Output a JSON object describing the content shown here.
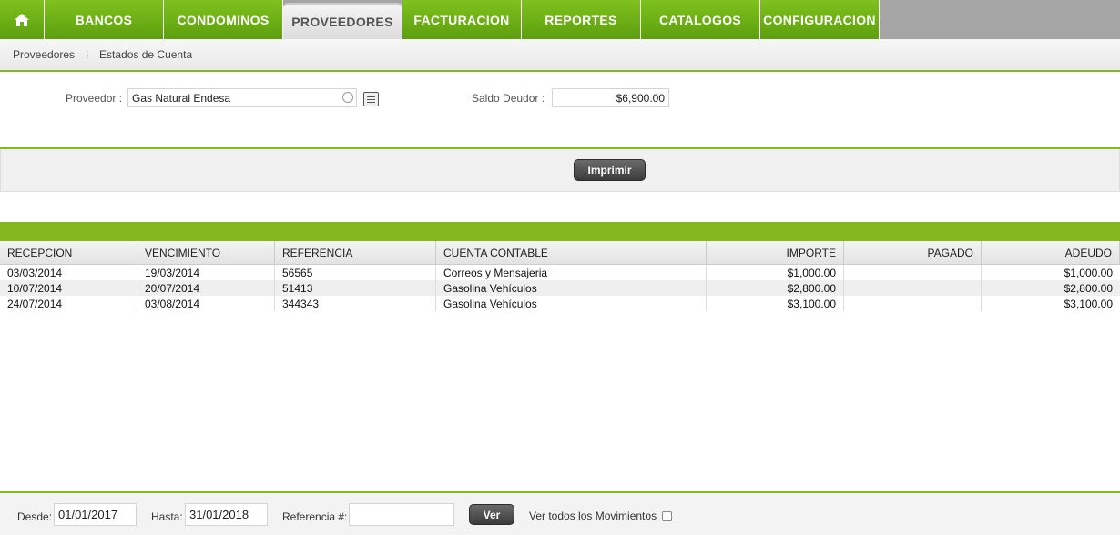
{
  "nav": {
    "home": "home-icon",
    "tabs": [
      "BANCOS",
      "CONDOMINOS",
      "PROVEEDORES",
      "FACTURACION",
      "REPORTES",
      "CATALOGOS",
      "CONFIGURACION"
    ],
    "active": "PROVEEDORES"
  },
  "breadcrumb": {
    "items": [
      "Proveedores",
      "Estados de Cuenta"
    ]
  },
  "form": {
    "proveedor_label": "Proveedor :",
    "proveedor_value": "Gas Natural Endesa",
    "saldo_label": "Saldo Deudor :",
    "saldo_value": "$6,900.00"
  },
  "actions": {
    "imprimir": "Imprimir"
  },
  "table": {
    "headers": [
      "RECEPCION",
      "VENCIMIENTO",
      "REFERENCIA",
      "CUENTA CONTABLE",
      "IMPORTE",
      "PAGADO",
      "ADEUDO"
    ],
    "rows": [
      [
        "03/03/2014",
        "19/03/2014",
        "56565",
        "Correos y Mensajeria",
        "$1,000.00",
        "",
        "$1,000.00"
      ],
      [
        "10/07/2014",
        "20/07/2014",
        "51413",
        "Gasolina Vehículos",
        "$2,800.00",
        "",
        "$2,800.00"
      ],
      [
        "24/07/2014",
        "03/08/2014",
        "344343",
        "Gasolina Vehículos",
        "$3,100.00",
        "",
        "$3,100.00"
      ]
    ]
  },
  "filters": {
    "desde_label": "Desde:",
    "desde_value": "01/01/2017",
    "hasta_label": "Hasta:",
    "hasta_value": "31/01/2018",
    "referencia_label": "Referencia #:",
    "referencia_value": "",
    "ver_label": "Ver",
    "ver_todos_label": "Ver todos los Movimientos",
    "ver_todos_checked": false
  },
  "colors": {
    "accent": "#7fc11e",
    "accent_dark": "#5d9f0f",
    "band": "#84b91d"
  }
}
